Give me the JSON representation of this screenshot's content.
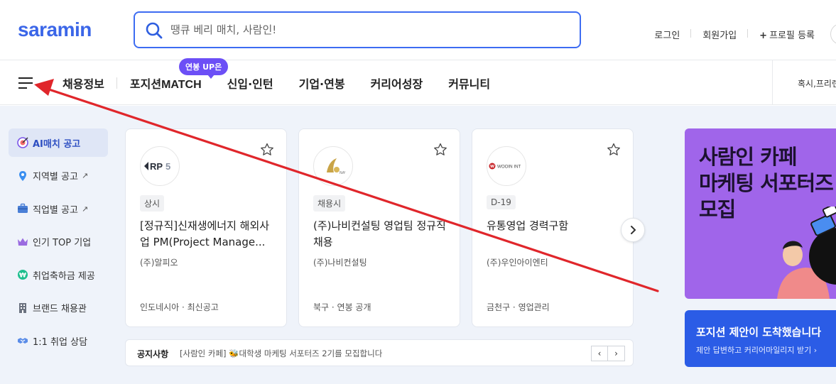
{
  "header": {
    "logo": "saramin",
    "search_placeholder": "땡큐 베리 매치, 사람인!",
    "links": {
      "login": "로그인",
      "signup": "회원가입",
      "profile": "프로필 등록",
      "profile_plus": "+"
    }
  },
  "nav": {
    "items": [
      "채용정보",
      "포지션",
      "신입·인턴",
      "기업·연봉",
      "커리어성장",
      "커뮤니티"
    ],
    "match": "MATCH",
    "badge": "연봉 UP은",
    "right_text": "혹시,프리랜"
  },
  "sidebar": {
    "items": [
      {
        "label": "AI매치 공고",
        "icon": "target-icon"
      },
      {
        "label": "지역별 공고",
        "icon": "location-pin-icon",
        "ext": "↗"
      },
      {
        "label": "직업별 공고",
        "icon": "briefcase-icon",
        "ext": "↗"
      },
      {
        "label": "인기 TOP 기업",
        "icon": "crown-icon"
      },
      {
        "label": "취업축하금 제공",
        "icon": "won-coin-icon"
      },
      {
        "label": "브랜드 채용관",
        "icon": "building-icon"
      },
      {
        "label": "1:1 취업 상담",
        "icon": "handshake-icon"
      }
    ]
  },
  "cards": [
    {
      "tag": "상시",
      "title": "[정규직]신재생에너지 해외사업 PM(Project Manage...",
      "company": "(주)알피오",
      "meta": "인도네시아 · 최신공고",
      "logo_text": "RPS"
    },
    {
      "tag": "채용시",
      "title": "(주)나비컨설팅 영업팀 정규직 채용",
      "company": "(주)나비컨설팅",
      "meta": "북구 · 연봉 공개",
      "logo_text": "NAVI"
    },
    {
      "tag": "D-19",
      "title": "유통영업 경력구함",
      "company": "(주)우인아이엔티",
      "meta": "금천구 · 영업관리",
      "logo_text": "WOOIN INT"
    }
  ],
  "notice": {
    "label": "공지사항",
    "text": "[사람인 카페] 🐝대학생 마케팅 서포터즈 2기를 모집합니다",
    "prev": "‹",
    "next": "›"
  },
  "banner": {
    "title": "사람인 카페\n마케팅 서포터즈\n모집"
  },
  "banner2": {
    "title": "포지션 제안이 도착했습니다",
    "subtitle": "제안 답변하고 커리어마일리지 받기 ›"
  },
  "colors": {
    "brand": "#3b66e8",
    "main_bg": "#eff3fa",
    "badge": "#6c4ff6",
    "banner_purple": "#a065ea",
    "banner_blue": "#2b5ce6",
    "annotation_arrow": "#e0262b"
  }
}
